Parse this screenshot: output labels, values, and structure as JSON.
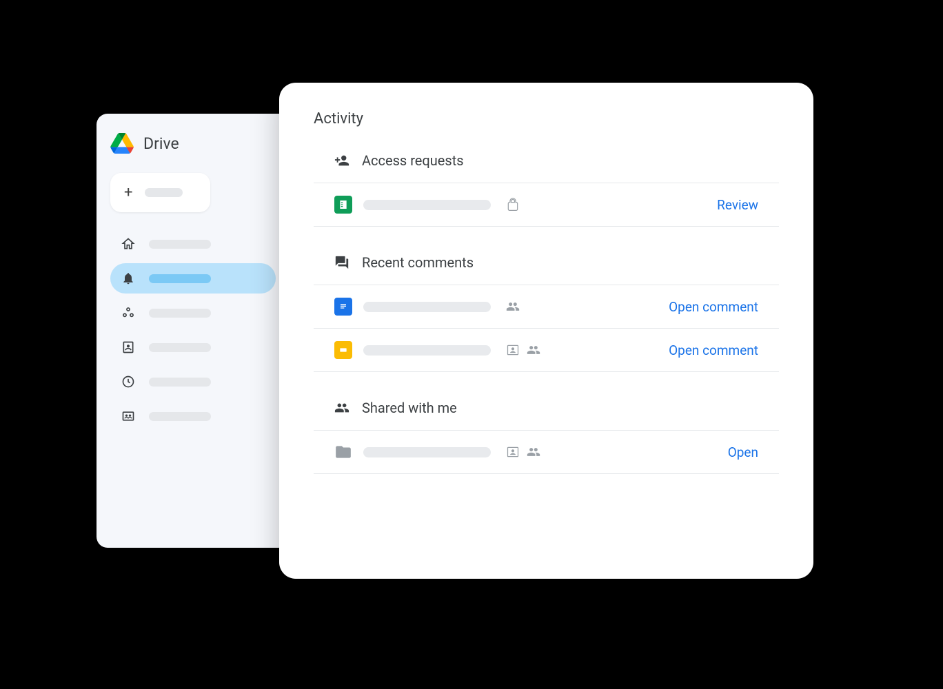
{
  "sidebar": {
    "title": "Drive"
  },
  "panel": {
    "title": "Activity",
    "sections": {
      "access_requests": {
        "title": "Access requests",
        "items": [
          {
            "action": "Review"
          }
        ]
      },
      "recent_comments": {
        "title": "Recent comments",
        "items": [
          {
            "action": "Open comment"
          },
          {
            "action": "Open comment"
          }
        ]
      },
      "shared_with_me": {
        "title": "Shared with me",
        "items": [
          {
            "action": "Open"
          }
        ]
      }
    }
  }
}
